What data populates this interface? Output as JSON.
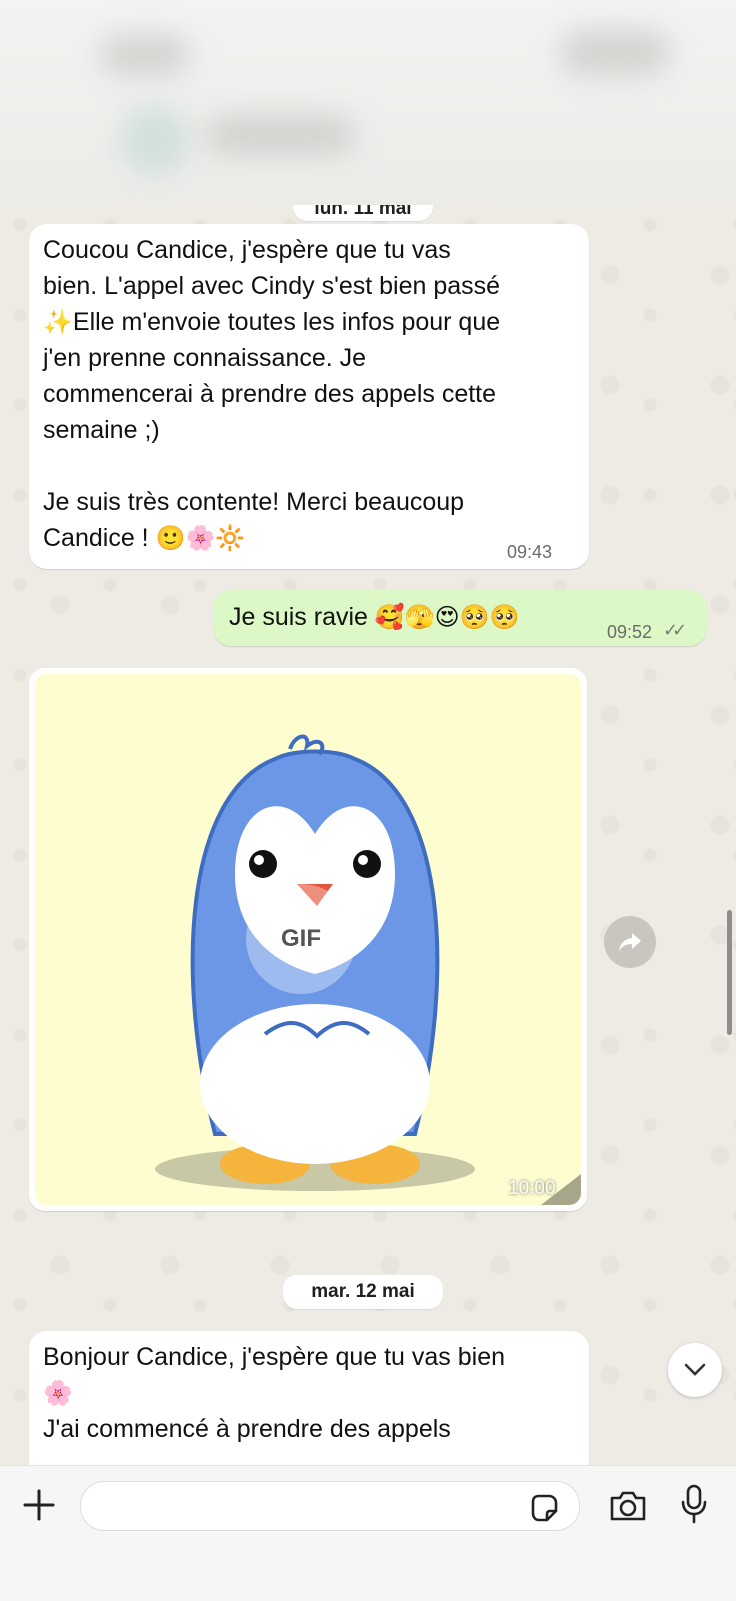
{
  "chat": {
    "date_chip_1": "lun. 11 mai",
    "date_chip_2": "mar. 12 mai",
    "messages": [
      {
        "direction": "incoming",
        "lines": [
          "Coucou Candice, j'espère que tu vas",
          "bien. L'appel avec Cindy s'est bien passé",
          "Elle m'envoie toutes les infos pour que",
          "j'en prenne connaissance. Je",
          "commencerai à prendre des appels cette",
          "semaine ;)",
          "Je suis très contente! Merci beaucoup",
          "Candice !"
        ],
        "emoji_sparkles": "✨",
        "emoji_end": "🙂🌸🔆",
        "time": "09:43"
      },
      {
        "direction": "outgoing",
        "text": "Je suis ravie",
        "emoji": "🥰🫣😍🥺🥺",
        "time": "09:52",
        "status_ticks": "✓✓"
      },
      {
        "direction": "incoming",
        "type": "gif",
        "badge": "GIF",
        "time": "10:00"
      },
      {
        "direction": "incoming",
        "lines": [
          "Bonjour Candice, j'espère que tu vas bien",
          "J'ai commencé à prendre des appels"
        ],
        "emoji_flower": "🌸"
      }
    ]
  },
  "icons": {
    "attach": "plus-icon",
    "sticker": "sticker-icon",
    "camera": "camera-icon",
    "mic": "microphone-icon",
    "forward": "forward-icon",
    "scroll_down": "chevron-down-icon"
  },
  "colors": {
    "outgoing_bubble": "#dcf8c6",
    "incoming_bubble": "#ffffff",
    "chat_background": "#efeae2"
  }
}
